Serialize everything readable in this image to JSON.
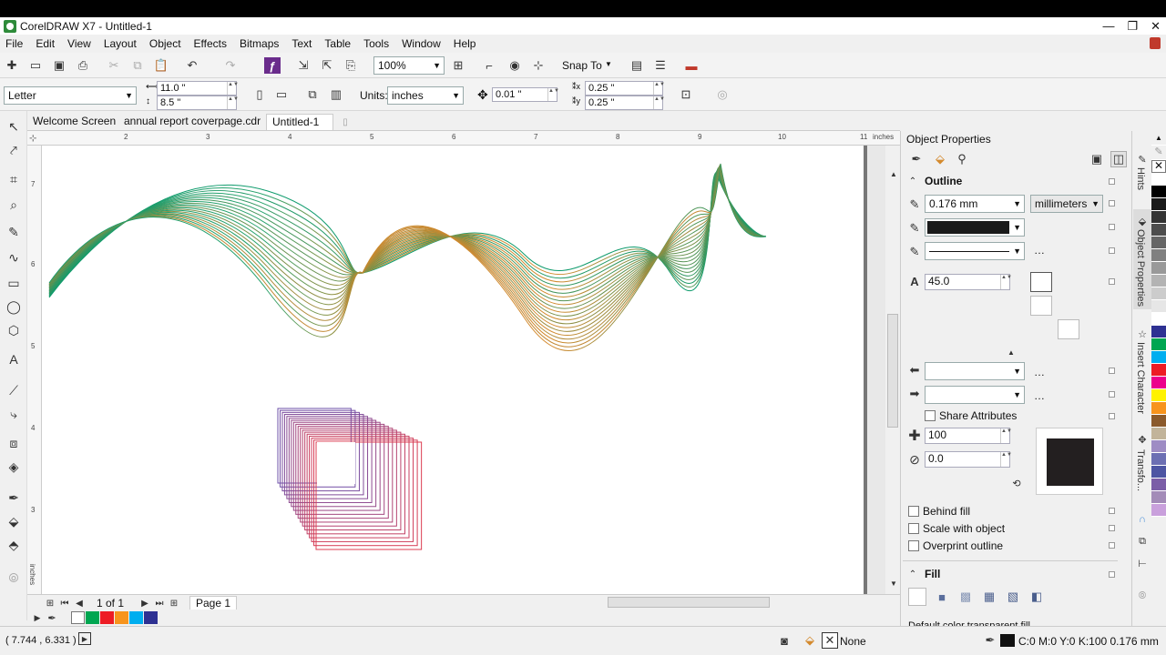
{
  "window": {
    "title": "CorelDRAW X7 - Untitled-1",
    "controls": [
      "—",
      "❐",
      "✕"
    ]
  },
  "menu": [
    "File",
    "Edit",
    "View",
    "Layout",
    "Object",
    "Effects",
    "Bitmaps",
    "Text",
    "Table",
    "Tools",
    "Window",
    "Help"
  ],
  "toolbar": {
    "zoom": "100%",
    "snap_to": "Snap To"
  },
  "propbar": {
    "paper": "Letter",
    "width": "11.0 \"",
    "height": "8.5 \"",
    "units_label": "Units:",
    "units": "inches",
    "nudge": "0.01 \"",
    "dup_x": "0.25 \"",
    "dup_y": "0.25 \""
  },
  "doc_tabs": [
    "Welcome Screen",
    "annual report coverpage.cdr",
    "Untitled-1"
  ],
  "ruler": {
    "h_ticks": [
      "2",
      "3",
      "4",
      "5",
      "6",
      "7",
      "8",
      "9",
      "10",
      "11"
    ],
    "h_unit": "inches",
    "v_ticks": [
      "7",
      "6",
      "5",
      "4",
      "3"
    ],
    "v_unit": "inches"
  },
  "pagenav": {
    "count": "1 of 1",
    "page": "Page 1"
  },
  "docker": {
    "title": "Object Properties",
    "outline_title": "Outline",
    "width": "0.176 mm",
    "units": "millimeters",
    "miter": "45.0",
    "share_attributes": "Share Attributes",
    "stretch": "100",
    "angle": "0.0",
    "behind_fill": "Behind fill",
    "scale_with_object": "Scale with object",
    "overprint_outline": "Overprint outline",
    "fill_title": "Fill",
    "fill_desc": "Default color transparent fill"
  },
  "side_tabs": [
    "Hints",
    "Object Properties",
    "Insert Character",
    "Transfo..."
  ],
  "status": {
    "coords": "( 7.744 , 6.331 )",
    "fill": "None",
    "outline": "C:0 M:0 Y:0 K:100  0.176 mm"
  },
  "colors": {
    "swatches": [
      "#00a651",
      "#ed1c24",
      "#f7941d",
      "#00aeef",
      "#2e3192"
    ],
    "palette": [
      "#ffffff",
      "#000000",
      "#1a1a1a",
      "#333333",
      "#4d4d4d",
      "#666666",
      "#808080",
      "#999999",
      "#b3b3b3",
      "#cccccc",
      "#e6e6e6",
      "#ffffff",
      "#2e3192",
      "#00a651",
      "#00aeef",
      "#ed1c24",
      "#ec008c",
      "#fff200",
      "#f7941d",
      "#8b5a2b",
      "#c2b49a",
      "#9e8cc4",
      "#6c6fb3",
      "#4d55a3",
      "#7b5ea7",
      "#a38bb8",
      "#c9a0dc"
    ]
  }
}
